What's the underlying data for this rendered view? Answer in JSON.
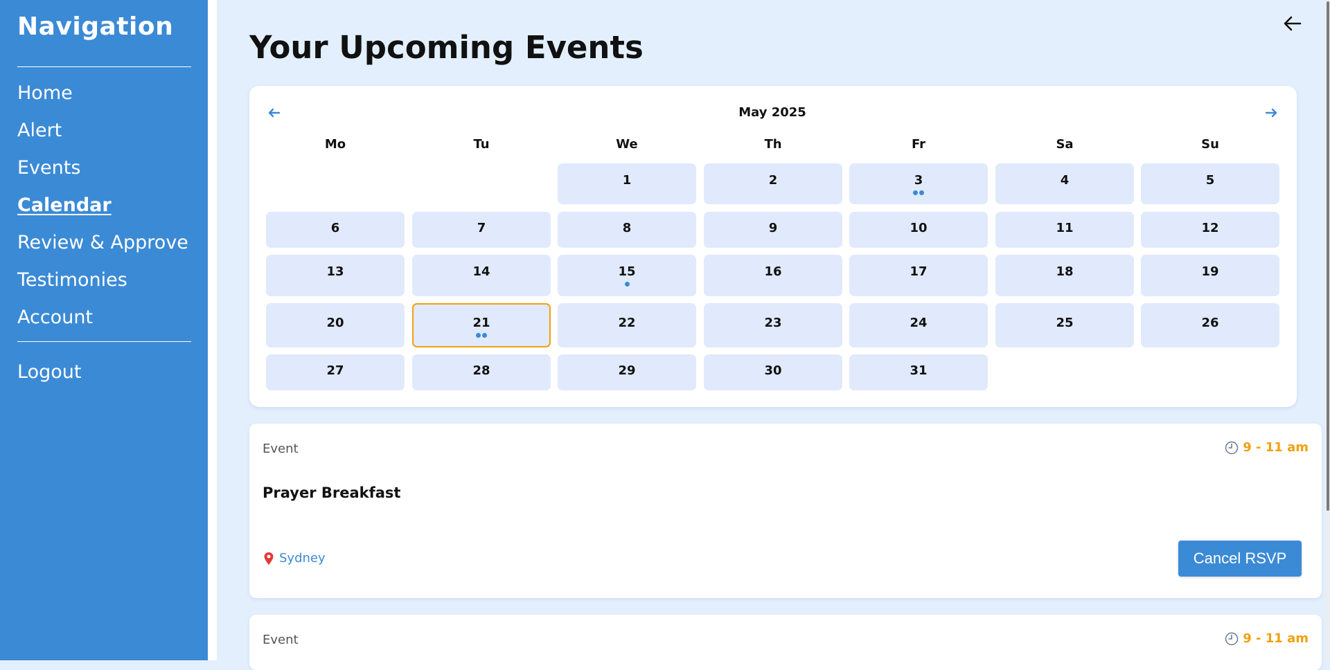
{
  "sidebar": {
    "title": "Navigation",
    "items": [
      {
        "label": "Home"
      },
      {
        "label": "Alert"
      },
      {
        "label": "Events"
      },
      {
        "label": "Calendar",
        "active": true
      },
      {
        "label": "Review & Approve"
      },
      {
        "label": "Testimonies"
      },
      {
        "label": "Account"
      }
    ],
    "logout": "Logout"
  },
  "header": {
    "title": "Your Upcoming Events",
    "back_icon": "arrow-left-icon"
  },
  "calendar": {
    "month_label": "May 2025",
    "prev_icon": "arrow-left-icon",
    "next_icon": "arrow-right-icon",
    "weekdays": [
      "Mo",
      "Tu",
      "We",
      "Th",
      "Fr",
      "Sa",
      "Su"
    ],
    "first_weekday_index": 2,
    "days_in_month": 31,
    "selected_day": 21,
    "event_dots": {
      "3": 2,
      "15": 1,
      "21": 2
    },
    "colors": {
      "cell": "#e1eafc",
      "selected_border": "#f0a010",
      "dot": "#3b8ad6"
    }
  },
  "events": [
    {
      "type": "Event",
      "time": "9 - 11 am",
      "title": "Prayer Breakfast",
      "location": "Sydney",
      "action": "Cancel RSVP"
    },
    {
      "type": "Event",
      "time": "9 - 11 am"
    }
  ],
  "colors": {
    "primary": "#3b8ad6",
    "accent": "#f0a010",
    "background": "#e3effd"
  }
}
